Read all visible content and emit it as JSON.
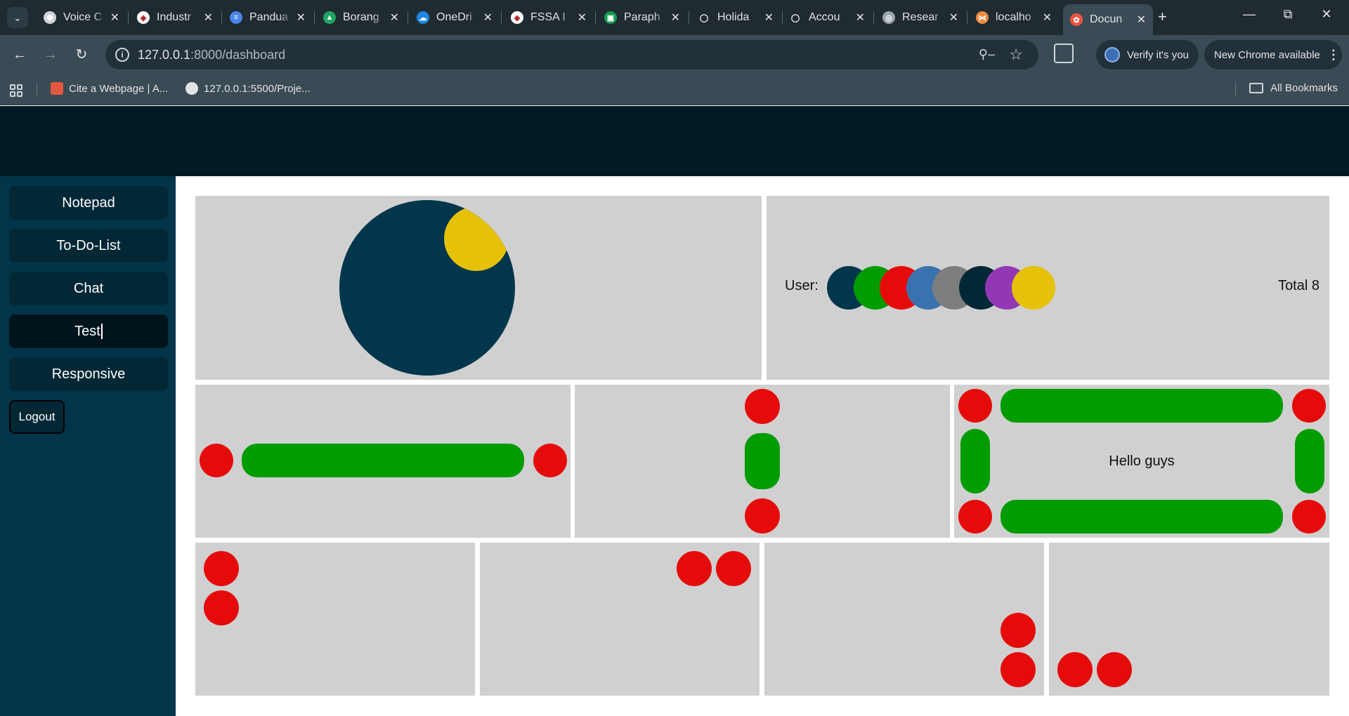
{
  "browser": {
    "tabs": [
      {
        "title": "Voice C",
        "favicon": "openai-icon",
        "color": "#cfd6db"
      },
      {
        "title": "Industr",
        "favicon": "crest-icon",
        "color": "#ffffff"
      },
      {
        "title": "Pandua",
        "favicon": "docs-icon",
        "color": "#4a86e8"
      },
      {
        "title": "Borang",
        "favicon": "drive-icon",
        "color": "#1fa463"
      },
      {
        "title": "OneDri",
        "favicon": "cloud-icon",
        "color": "#1e88e5"
      },
      {
        "title": "FSSA I",
        "favicon": "crest-icon",
        "color": "#ffffff"
      },
      {
        "title": "Paraph",
        "favicon": "robot-icon",
        "color": "#119c4f"
      },
      {
        "title": "Holida",
        "favicon": "github-icon",
        "color": "#1f2a31"
      },
      {
        "title": "Accou",
        "favicon": "github-icon",
        "color": "#1f2a31"
      },
      {
        "title": "Resear",
        "favicon": "globe-icon",
        "color": "#9aa5ad"
      },
      {
        "title": "localho",
        "favicon": "xampp-icon",
        "color": "#f0883e"
      },
      {
        "title": "Docun",
        "favicon": "laravel-icon",
        "color": "#f05340",
        "active": true
      }
    ],
    "url_host": "127.0.0.1",
    "url_path": ":8000/dashboard",
    "verify_label": "Verify it's you",
    "update_label": "New Chrome available",
    "bookmarks": [
      {
        "label": "Cite a Webpage | A...",
        "icon": "cite-icon"
      },
      {
        "label": "127.0.0.1:5500/Proje...",
        "icon": "globe-icon"
      }
    ],
    "all_bookmarks_label": "All Bookmarks"
  },
  "sidebar": {
    "items": [
      {
        "label": "Notepad"
      },
      {
        "label": "To-Do-List"
      },
      {
        "label": "Chat"
      },
      {
        "label": "Test",
        "active": true
      },
      {
        "label": "Responsive"
      }
    ],
    "logout_label": "Logout"
  },
  "main": {
    "pie": {
      "slices": [
        {
          "fraction": 0.125,
          "color": "#e6c10a"
        },
        {
          "fraction": 0.875,
          "color": "#02364c"
        }
      ]
    },
    "users": {
      "label": "User:",
      "total_label": "Total 8",
      "colors": [
        "#02364c",
        "#009c00",
        "#e60b0b",
        "#3a72b0",
        "#7d7d7d",
        "#022836",
        "#9338b4",
        "#e6c10a"
      ]
    },
    "hello_text": "Hello guys",
    "colors": {
      "dot": "#e60b0b",
      "bar": "#009c00",
      "panel": "#d0d0d0",
      "sidebar": "#02344a",
      "topbar": "#001b25"
    }
  }
}
